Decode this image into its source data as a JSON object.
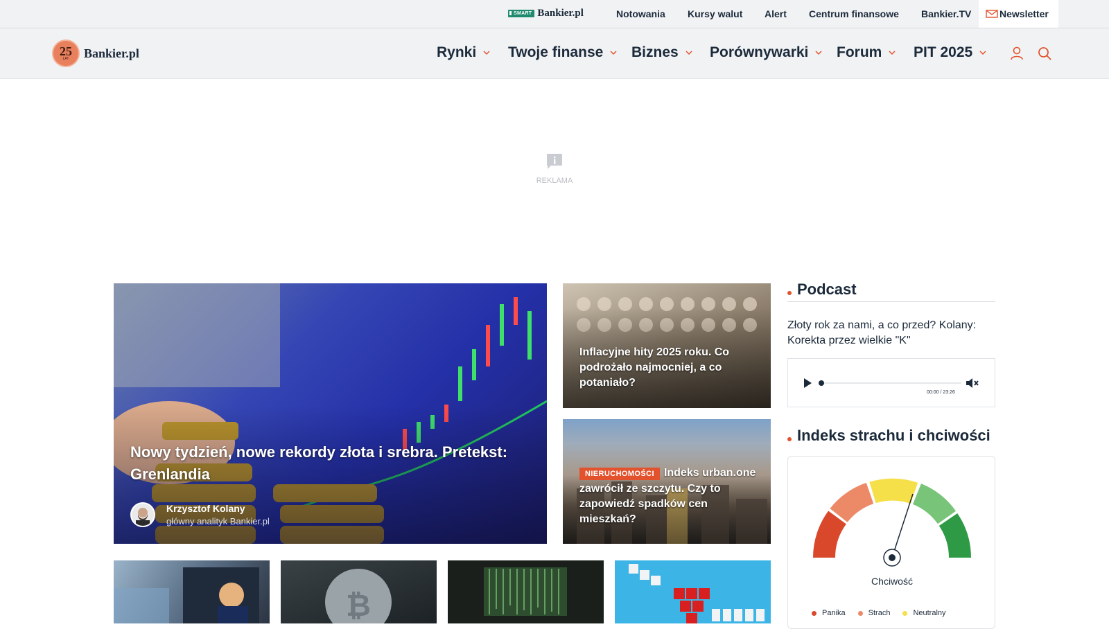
{
  "topbar": {
    "smart_badge": "SMART",
    "smart_brand": "Bankier.pl",
    "links": [
      "Notowania",
      "Kursy walut",
      "Alert",
      "Centrum finansowe",
      "Bankier.TV"
    ],
    "newsletter": "Newsletter"
  },
  "logo": {
    "years": "25",
    "years_caption": "LAT",
    "brand": "Bankier.pl"
  },
  "nav": {
    "items": [
      "Rynki",
      "Twoje finanse",
      "Biznes",
      "Porównywarki",
      "Forum",
      "PIT 2025"
    ]
  },
  "ad": {
    "label": "REKLAMA"
  },
  "hero": {
    "title": "Nowy tydzień, nowe rekordy złota i srebra. Pretekst: Grenlandia",
    "author_name": "Krzysztof Kolany",
    "author_role": "główny analityk Bankier.pl"
  },
  "tiles": [
    {
      "tag": "",
      "title": "Inflacyjne hity 2025 roku. Co podrożało najmocniej, a co potaniało?"
    },
    {
      "tag": "NIERUCHOMOŚCI",
      "title": "Indeks urban.one zawrócił ze szczytu. Czy to zapowiedź spadków cen mieszkań?"
    }
  ],
  "podcast": {
    "heading": "Podcast",
    "episode_title": "Złoty rok za nami, a co przed? Kolany: Korekta przez wielkie \"K\"",
    "time": "00:00 / 23:26",
    "progress": 0
  },
  "fear_greed": {
    "heading": "Indeks strachu i chciwości",
    "current_label": "Chciwość",
    "legend": [
      "Panika",
      "Strach",
      "Neutralny"
    ],
    "colors": {
      "panika": "#d9482a",
      "strach": "#ec8a68",
      "neutralny": "#f5e04a",
      "chciwosc": "#78c479",
      "euforia": "#2f9a45"
    }
  },
  "colors": {
    "accent": "#e2522d",
    "text": "#1b2a3a"
  }
}
